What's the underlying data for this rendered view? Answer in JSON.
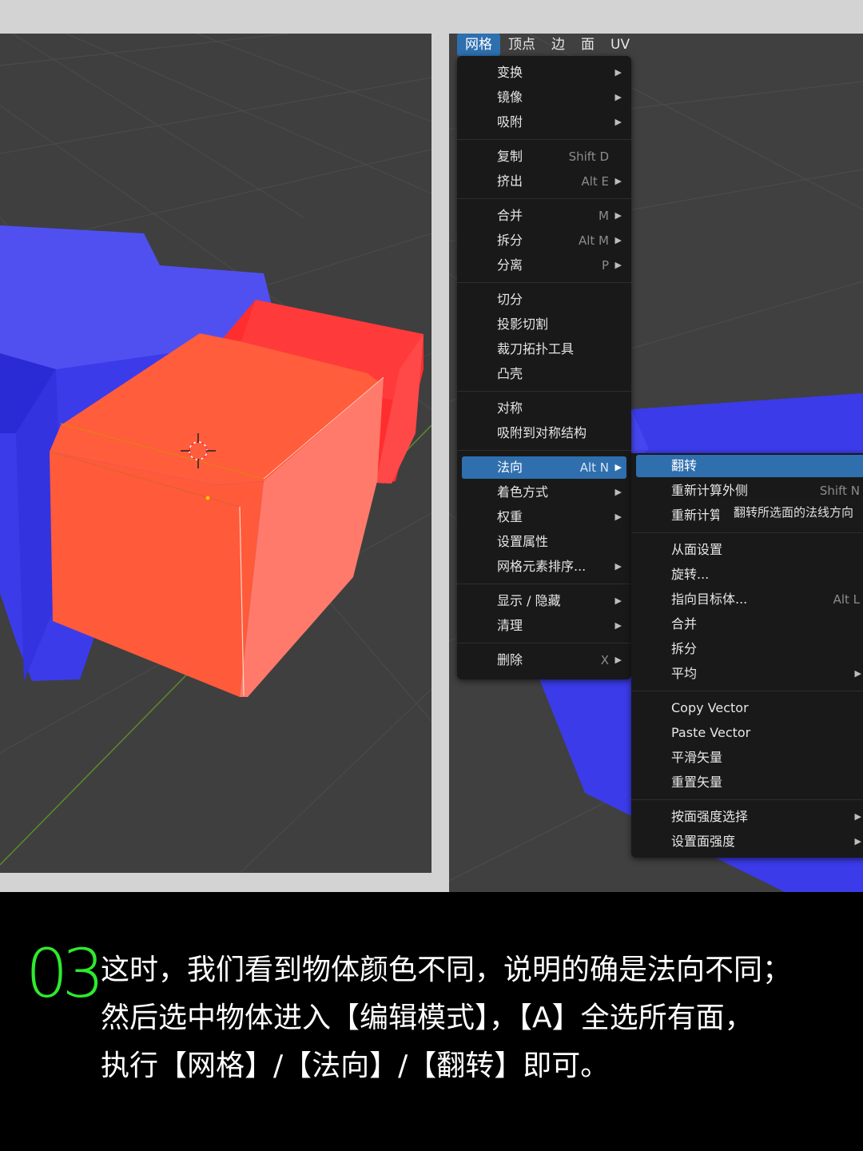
{
  "menubar": {
    "items": [
      {
        "label": "网格",
        "active": true
      },
      {
        "label": "顶点",
        "active": false
      },
      {
        "label": "边",
        "active": false
      },
      {
        "label": "面",
        "active": false
      },
      {
        "label": "UV",
        "active": false
      }
    ]
  },
  "mesh_menu": {
    "transform": "变换",
    "mirror": "镜像",
    "snap": "吸附",
    "duplicate": "复制",
    "duplicate_sc": "Shift D",
    "extrude": "挤出",
    "extrude_sc": "Alt E",
    "merge": "合并",
    "merge_sc": "M",
    "split": "拆分",
    "split_sc": "Alt M",
    "separate": "分离",
    "separate_sc": "P",
    "bisect": "切分",
    "knife_project": "投影切割",
    "knife_topology": "裁刀拓扑工具",
    "convex_hull": "凸壳",
    "symmetrize": "对称",
    "snap_symmetry": "吸附到对称结构",
    "normals": "法向",
    "normals_sc": "Alt N",
    "shading": "着色方式",
    "weights": "权重",
    "set_attribute": "设置属性",
    "sort_elements": "网格元素排序...",
    "show_hide": "显示 / 隐藏",
    "clean_up": "清理",
    "delete": "删除",
    "delete_sc": "X"
  },
  "normals_menu": {
    "flip": "翻转",
    "recalc_outside": "重新计算外侧",
    "recalc_outside_sc": "Shift N",
    "recalc_inside": "重新计算",
    "set_from_faces": "从面设置",
    "rotate": "旋转...",
    "point_to_target": "指向目标体...",
    "point_to_target_sc": "Alt L",
    "merge": "合并",
    "split": "拆分",
    "average": "平均",
    "copy_vector": "Copy Vector",
    "paste_vector": "Paste Vector",
    "smooth_vectors": "平滑矢量",
    "reset_vectors": "重置矢量",
    "select_by_face_strength": "按面强度选择",
    "set_face_strength": "设置面强度"
  },
  "tooltip": "翻转所选面的法线方向",
  "caption": {
    "step": "03",
    "line1": "这时，我们看到物体颜色不同，说明的确是法向不同；",
    "line2": "然后选中物体进入【编辑模式】，【A】全选所有面，",
    "line3": "执行【网格】/【法向】/【翻转】即可。"
  },
  "colors": {
    "highlight": "#2f6fae",
    "step_number": "#2eea2e",
    "object_blue": "#3a3aec",
    "face_orange": "#ff5a38",
    "face_red": "#ff2f2f"
  }
}
